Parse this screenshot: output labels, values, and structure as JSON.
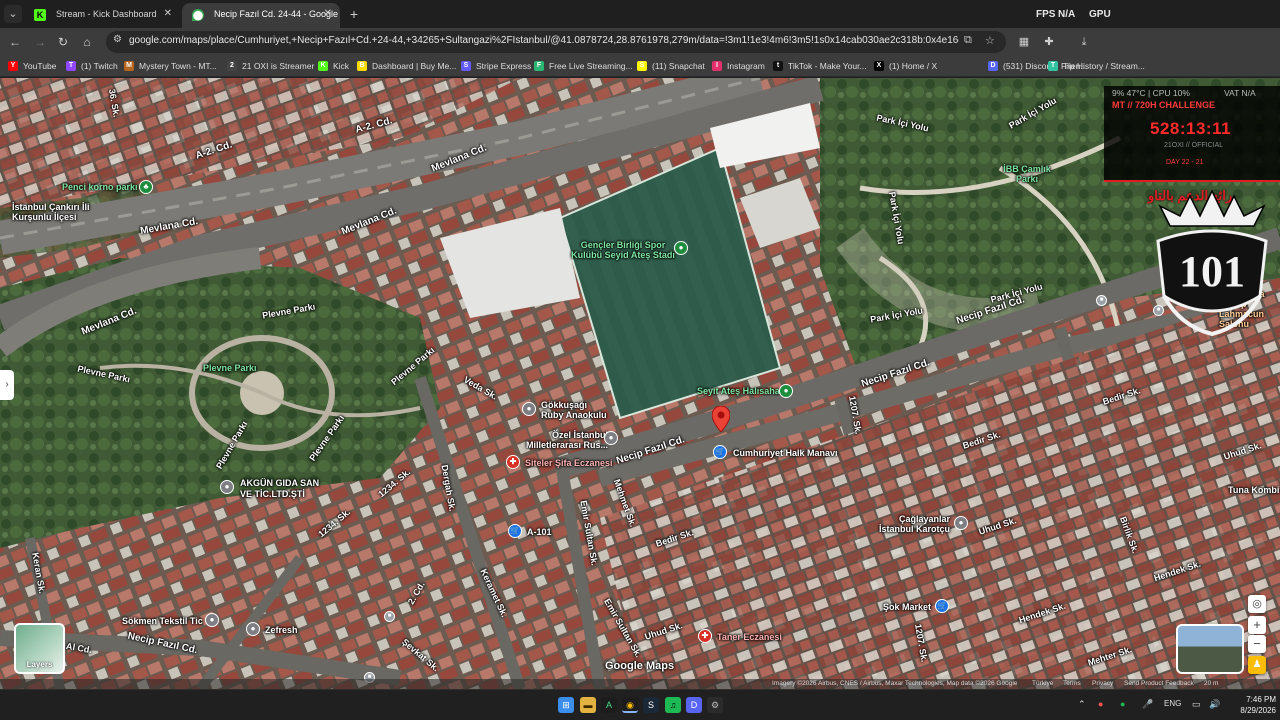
{
  "browser": {
    "tabs": [
      {
        "title": "Stream - Kick Dashboard",
        "active": false,
        "favicon": "kick-logo-icon",
        "color": "#53fc18"
      },
      {
        "title": "Necip Fazıl Cd. 24-44 - Google",
        "active": true,
        "favicon": "google-maps-icon",
        "color": "#34a853"
      }
    ],
    "new_tab": "+",
    "fps_label": "FPS",
    "fps_value": "N/A",
    "gpu_label": "GPU",
    "url": "google.com/maps/place/Cumhuriyet,+Necip+Fazıl+Cd.+24-44,+34265+Sultangazi%2Fİstanbul/@41.0878724,28.8761978,279m/data=!3m1!1e3!4m6!3m5!1s0x14cab030ae2c318b:0x4e16c9f26cef8881...",
    "bookmarks": [
      {
        "label": "YouTube",
        "color": "#ff0000",
        "icon": "Y"
      },
      {
        "label": "(1) Twitch",
        "color": "#9146ff",
        "icon": "T"
      },
      {
        "label": "Mystery Town - MT...",
        "color": "#b5651d",
        "icon": "M"
      },
      {
        "label": "21 OXI is Streamer",
        "color": "#444444",
        "icon": "2"
      },
      {
        "label": "Kick",
        "color": "#53fc18",
        "icon": "K"
      },
      {
        "label": "Dashboard | Buy Me...",
        "color": "#ffdd00",
        "icon": "B"
      },
      {
        "label": "Stripe Express",
        "color": "#635bff",
        "icon": "S"
      },
      {
        "label": "Free Live Streaming...",
        "color": "#2bb673",
        "icon": "F"
      },
      {
        "label": "(11) Snapchat",
        "color": "#fffc00",
        "icon": "S"
      },
      {
        "label": "Instagram",
        "color": "#e1306c",
        "icon": "I"
      },
      {
        "label": "TikTok - Make Your...",
        "color": "#111111",
        "icon": "t"
      },
      {
        "label": "(1) Home / X",
        "color": "#000000",
        "icon": "X"
      },
      {
        "label": "(531) Discord | Frien...",
        "color": "#5865f2",
        "icon": "D"
      },
      {
        "label": "Tip History / Stream...",
        "color": "#31c3a2",
        "icon": "T"
      }
    ]
  },
  "stream_overlay": {
    "stats": "9% 47°C | CPU 10%",
    "stats_right": "VAT N/A",
    "challenge": "MT // 720H CHALLENGE",
    "timer": "528:13:11",
    "channel": "21OXI // OFFICIAL",
    "sub": "DAY 22 - 21",
    "arabic": "رائع الدعم بالتاو",
    "emblem_text": "101"
  },
  "map": {
    "streets": [
      "Mevlana Cd.",
      "Mevlana Cd.",
      "Mevlana Cd.",
      "Mevlana Cd.",
      "A-2. Cd.",
      "A-2. Cd.",
      "Necip Fazıl Cd.",
      "Necip Fazıl Cd.",
      "Necip Fazıl Cd.",
      "Necip Fazıl Cd.",
      "Bedir Sk.",
      "Bedir Sk.",
      "Bedir Sk.",
      "Uhud Sk.",
      "Uhud Sk.",
      "Uhud Sk.",
      "Hendek Sk.",
      "Hendek Sk.",
      "Mehter Sk.",
      "1207. Sk.",
      "1207. Sk.",
      "Birlik Sk.",
      "Park İçi Yolu",
      "Park İçi Yolu",
      "Park İçi Yolu",
      "Park İçi Yolu",
      "Park İçi Yolu",
      "Plevne Parkı",
      "Plevne Parkı",
      "Plevne Parkı",
      "Plevne Parkı",
      "Plevne Parkı",
      "Veda Sk.",
      "Dergah Sk.",
      "1234. Sk.",
      "1234. Sk.",
      "Mehmet Sk.",
      "Emir Sultan Sk.",
      "Emir Sultan Sk.",
      "Keramet Sk.",
      "Şevkat Sk.",
      "Keran Sk.",
      "2. Cd.",
      "36. Sk.",
      "Al Cd."
    ],
    "places": [
      {
        "name": "Penci korno parkı",
        "pin": "green"
      },
      {
        "name": "İstanbul Çankırı İli Kurşunlu İlçesi",
        "pin": "gray"
      },
      {
        "name": "Gençler Birliği Spor Kulübü Seyid Ateş Stadı",
        "pin": "green"
      },
      {
        "name": "İBB Çamlık Parkı",
        "pin": "green"
      },
      {
        "name": "Plevne Parkı",
        "pin": "green"
      },
      {
        "name": "Seyit Ateş Halısaha",
        "pin": "green"
      },
      {
        "name": "Gökkuşağı Ruby Anaokulu",
        "pin": "gray"
      },
      {
        "name": "Özel İstanbul Milletlerarası Rus...",
        "pin": "gray"
      },
      {
        "name": "Siteler Şifa Eczanesi",
        "pin": "red"
      },
      {
        "name": "Cumhuriyet Halk Manavı",
        "pin": "blue"
      },
      {
        "name": "AKGÜN GIDA SAN VE TİC.LTD.ŞTİ",
        "pin": "gray"
      },
      {
        "name": "A-101",
        "pin": "blue"
      },
      {
        "name": "Çağlayanlar İstanbul Karotçu",
        "pin": "gray"
      },
      {
        "name": "Tuna Kombi",
        "pin": "gray"
      },
      {
        "name": "44 Malatya Kebap Lahmacun Salonu",
        "pin": "orange"
      },
      {
        "name": "Sökmen Tekstil Tic",
        "pin": "gray"
      },
      {
        "name": "Zefresh",
        "pin": "gray"
      },
      {
        "name": "Şok Market",
        "pin": "blue"
      },
      {
        "name": "Taner Eczanesi",
        "pin": "red"
      }
    ],
    "google_maps_logo": "Google Maps",
    "layers_label": "Layers",
    "attribution": "Imagery ©2026 Airbus, CNES / Airbus, Maxar Technologies, Map data ©2026 Google",
    "attribution_links": [
      "Türkiye",
      "Terms",
      "Privacy",
      "Send Product Feedback"
    ],
    "scale": "20 m",
    "zoom_in": "+",
    "zoom_out": "−"
  },
  "taskbar": {
    "lang": "ENG",
    "time": "7:46 PM",
    "date": "8/29/2026"
  }
}
